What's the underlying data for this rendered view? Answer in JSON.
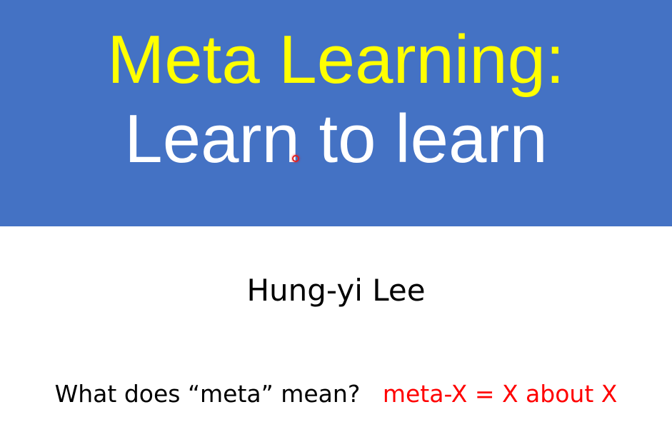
{
  "slide": {
    "title_line_1": "Meta Learning:",
    "title_line_2": "Learn to learn",
    "author": "Hung-yi Lee",
    "question": "What does “meta” mean?",
    "definition": "meta-X = X about X"
  },
  "colors": {
    "title_band": "#4472c4",
    "title_line_1": "#ffff00",
    "title_line_2": "#ffffff",
    "definition": "#ff0000",
    "pointer": "#e02020"
  },
  "icons": {
    "pointer": "laser-pointer-icon"
  }
}
